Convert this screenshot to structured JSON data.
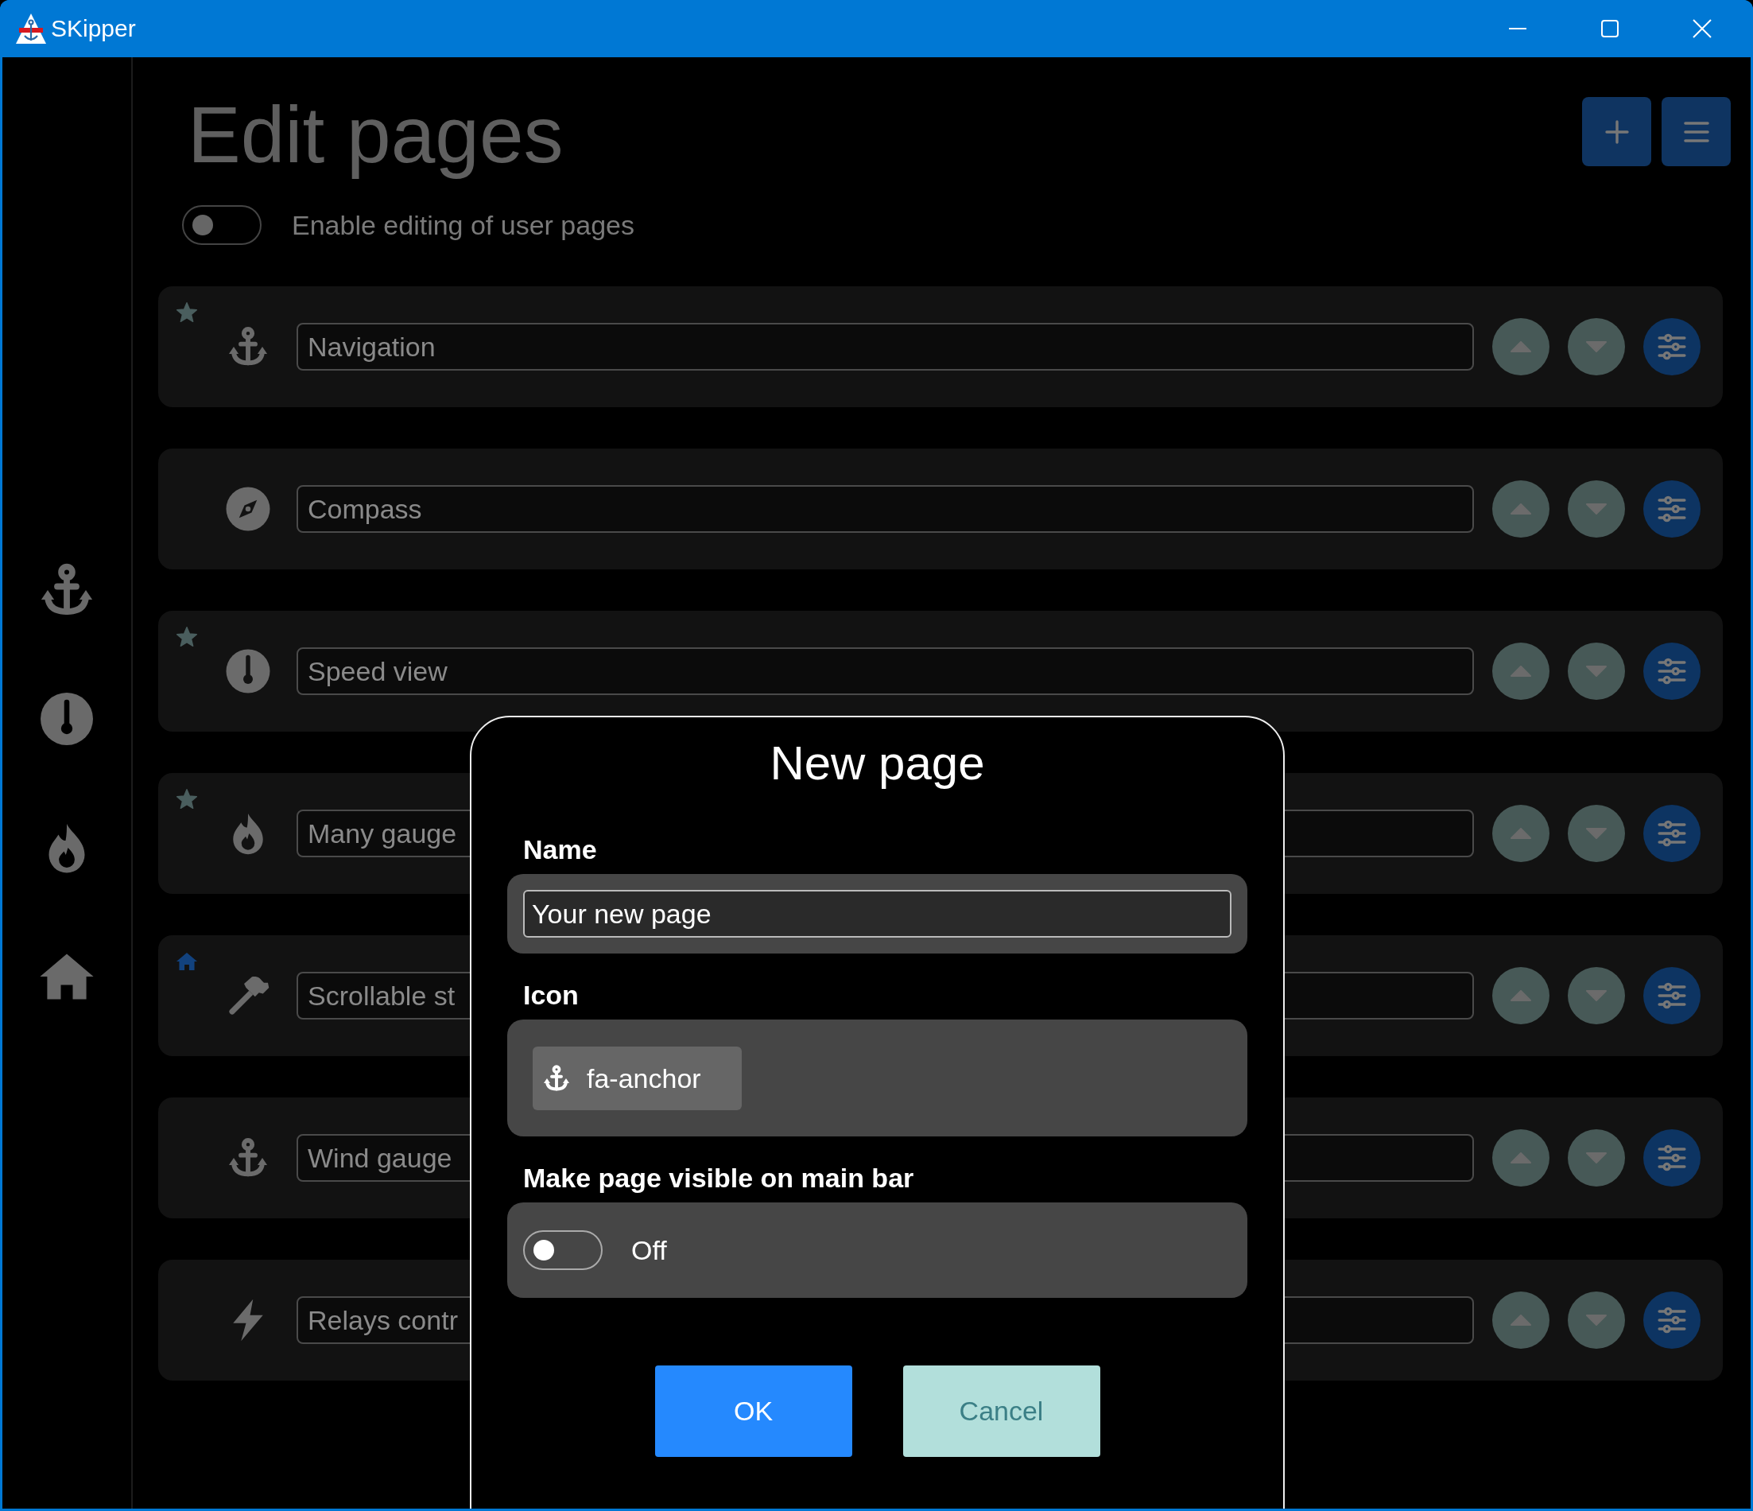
{
  "window": {
    "title": "SKipper"
  },
  "sidebar": {
    "items": [
      {
        "kind": "anchor"
      },
      {
        "kind": "thermometer"
      },
      {
        "kind": "fire"
      },
      {
        "kind": "home"
      }
    ]
  },
  "page": {
    "title": "Edit pages",
    "editing_toggle": {
      "on": false,
      "label": "Enable editing of user pages"
    }
  },
  "pages": [
    {
      "name": "Navigation",
      "kind": "anchor",
      "starred": true,
      "home": false
    },
    {
      "name": "Compass",
      "kind": "compass",
      "starred": false,
      "home": false
    },
    {
      "name": "Speed view",
      "kind": "thermometer",
      "starred": true,
      "home": false
    },
    {
      "name": "Many gauge",
      "kind": "fire",
      "starred": true,
      "home": false
    },
    {
      "name": "Scrollable st",
      "kind": "hammer",
      "starred": false,
      "home": true
    },
    {
      "name": "Wind gauge",
      "kind": "anchor",
      "starred": false,
      "home": false
    },
    {
      "name": "Relays contr",
      "kind": "bolt",
      "starred": false,
      "home": false
    }
  ],
  "dialog": {
    "title": "New page",
    "name_label": "Name",
    "name_value": "Your new page",
    "icon_label": "Icon",
    "icon_choice": {
      "kind": "anchor",
      "label": "fa-anchor"
    },
    "visible_label": "Make page visible on main bar",
    "visible": {
      "on": false,
      "text": "Off"
    },
    "buttons": [
      {
        "label": "OK",
        "kind": "primary"
      },
      {
        "label": "Cancel",
        "kind": "secondary"
      }
    ]
  }
}
